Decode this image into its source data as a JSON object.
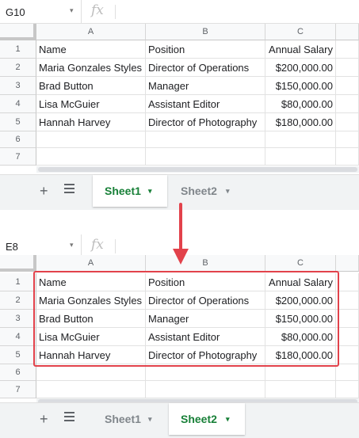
{
  "top": {
    "name_box": "G10",
    "fx": "fx",
    "columns": [
      "A",
      "B",
      "C"
    ],
    "row_numbers": [
      "1",
      "2",
      "3",
      "4",
      "5",
      "6",
      "7"
    ],
    "rows": [
      [
        "Name",
        "Position",
        "Annual Salary"
      ],
      [
        "Maria Gonzales Styles",
        "Director of Operations",
        "$200,000.00"
      ],
      [
        "Brad Button",
        "Manager",
        "$150,000.00"
      ],
      [
        "Lisa McGuier",
        "Assistant Editor",
        "$80,000.00"
      ],
      [
        "Hannah Harvey",
        "Director of Photography",
        "$180,000.00"
      ],
      [
        "",
        "",
        ""
      ],
      [
        "",
        "",
        ""
      ]
    ],
    "tabs": [
      {
        "label": "Sheet1",
        "active": true
      },
      {
        "label": "Sheet2",
        "active": false
      }
    ]
  },
  "bottom": {
    "name_box": "E8",
    "fx": "fx",
    "columns": [
      "A",
      "B",
      "C"
    ],
    "row_numbers": [
      "1",
      "2",
      "3",
      "4",
      "5",
      "6",
      "7"
    ],
    "rows": [
      [
        "Name",
        "Position",
        "Annual Salary"
      ],
      [
        "Maria Gonzales Styles",
        "Director of Operations",
        "$200,000.00"
      ],
      [
        "Brad Button",
        "Manager",
        "$150,000.00"
      ],
      [
        "Lisa McGuier",
        "Assistant Editor",
        "$80,000.00"
      ],
      [
        "Hannah Harvey",
        "Director of Photography",
        "$180,000.00"
      ],
      [
        "",
        "",
        ""
      ],
      [
        "",
        "",
        ""
      ]
    ],
    "tabs": [
      {
        "label": "Sheet1",
        "active": false
      },
      {
        "label": "Sheet2",
        "active": true
      }
    ]
  },
  "icons": {
    "add_sheet": "+",
    "sheet_list": "all-sheets-icon",
    "dropdown": "▾",
    "arrow": "down-arrow-icon"
  },
  "colors": {
    "active_tab_text": "#188038",
    "highlight": "#e2424b",
    "arrow": "#e2424b"
  }
}
